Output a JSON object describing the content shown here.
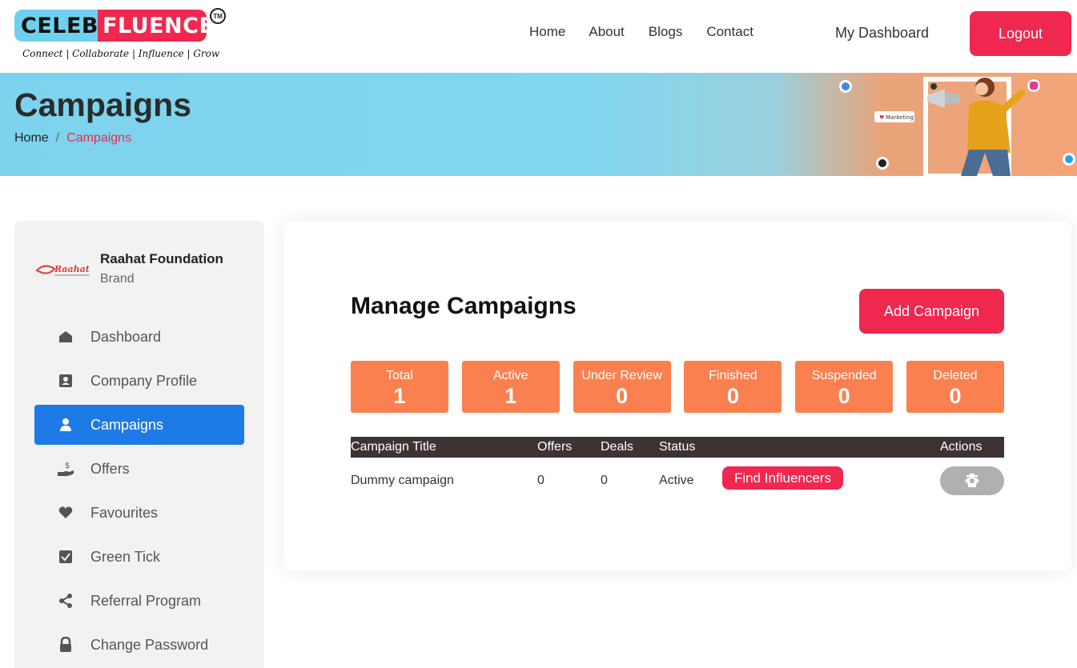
{
  "logo": {
    "part1": "CELEB",
    "part2": "FLUENCE",
    "tm": "TM",
    "tagline": "Connect | Collaborate | Influence | Grow"
  },
  "nav": {
    "items": [
      "Home",
      "About",
      "Blogs",
      "Contact"
    ],
    "my_dashboard": "My Dashboard",
    "logout": "Logout"
  },
  "banner": {
    "title": "Campaigns",
    "crumb_home": "Home",
    "crumb_sep": "/",
    "crumb_current": "Campaigns",
    "art_badge": "Marketing"
  },
  "sidebar": {
    "brand_name": "Raahat Foundation",
    "brand_role": "Brand",
    "brand_logo_text": "Raahat",
    "items": [
      {
        "label": "Dashboard",
        "icon": "home-icon"
      },
      {
        "label": "Company Profile",
        "icon": "id-card-icon"
      },
      {
        "label": "Campaigns",
        "icon": "user-icon",
        "active": true
      },
      {
        "label": "Offers",
        "icon": "hand-money-icon"
      },
      {
        "label": "Favourites",
        "icon": "heart-icon"
      },
      {
        "label": "Green Tick",
        "icon": "check-square-icon"
      },
      {
        "label": "Referral Program",
        "icon": "share-icon"
      },
      {
        "label": "Change Password",
        "icon": "lock-icon"
      }
    ]
  },
  "main": {
    "title": "Manage Campaigns",
    "add_button": "Add Campaign",
    "stats": [
      {
        "label": "Total",
        "value": "1"
      },
      {
        "label": "Active",
        "value": "1"
      },
      {
        "label": "Under Review",
        "value": "0"
      },
      {
        "label": "Finished",
        "value": "0"
      },
      {
        "label": "Suspended",
        "value": "0"
      },
      {
        "label": "Deleted",
        "value": "0"
      }
    ],
    "table": {
      "headers": {
        "title": "Campaign Title",
        "offers": "Offers",
        "deals": "Deals",
        "status": "Status",
        "actions": "Actions"
      },
      "rows": [
        {
          "title": "Dummy campaign",
          "offers": "0",
          "deals": "0",
          "status": "Active",
          "find": "Find Influencers"
        }
      ]
    }
  },
  "colors": {
    "brand_red": "#f0284f",
    "active_blue": "#1e7ae6",
    "stat_orange": "#fb8050",
    "table_head": "#3e3333"
  }
}
